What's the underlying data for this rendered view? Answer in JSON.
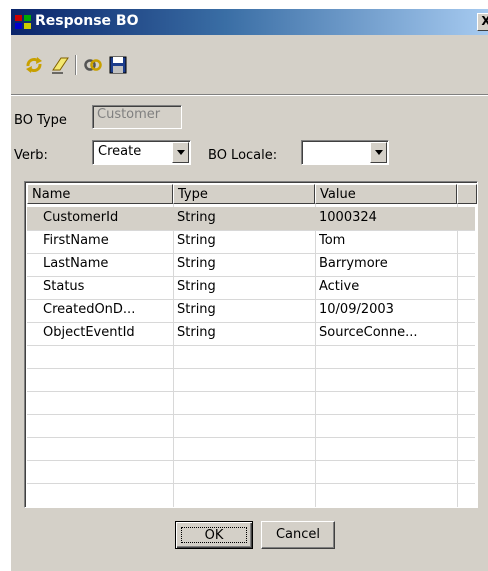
{
  "window": {
    "title": "Response BO",
    "close_label": "X"
  },
  "toolbar": {
    "items": [
      {
        "name": "refresh-icon"
      },
      {
        "name": "eraser-icon"
      },
      {
        "name": "link-icon"
      },
      {
        "name": "save-icon"
      }
    ]
  },
  "form": {
    "bo_type_label": "BO Type",
    "bo_type_value": "Customer",
    "verb_label": "Verb:",
    "verb_value": "Create",
    "locale_label": "BO Locale:",
    "locale_value": ""
  },
  "table": {
    "headers": [
      "Name",
      "Type",
      "Value"
    ],
    "rows": [
      {
        "name": "CustomerId",
        "type": "String",
        "value": "1000324"
      },
      {
        "name": "FirstName",
        "type": "String",
        "value": "Tom"
      },
      {
        "name": "LastName",
        "type": "String",
        "value": "Barrymore"
      },
      {
        "name": "Status",
        "type": "String",
        "value": "Active"
      },
      {
        "name": "CreatedOnD...",
        "type": "String",
        "value": "10/09/2003"
      },
      {
        "name": "ObjectEventId",
        "type": "String",
        "value": "SourceConne..."
      }
    ]
  },
  "buttons": {
    "ok": "OK",
    "cancel": "Cancel"
  }
}
